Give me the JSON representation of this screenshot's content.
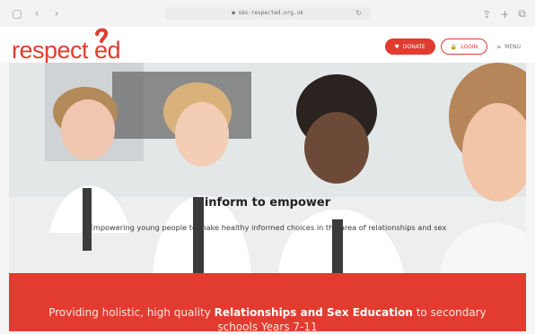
{
  "browser": {
    "url": "● sbs-respected.org.uk",
    "icons": [
      "sidebar-icon",
      "back-icon",
      "forward-icon",
      "refresh-icon",
      "share-icon",
      "new-tab-icon",
      "tabs-icon"
    ]
  },
  "header": {
    "logo_text": "respect ed",
    "donate_label": "DONATE",
    "login_label": "LOGIN",
    "menu_label": "MENU"
  },
  "hero": {
    "title": "inform to empower",
    "subtitle": "Empowering young people to make healthy informed choices in the area of relationships and sex"
  },
  "band": {
    "text_pre": "Providing holistic, high quality ",
    "text_bold": "Relationships and Sex Education",
    "text_post": " to secondary schools Years 7-11"
  },
  "colors": {
    "brand": "#e23b2f"
  }
}
